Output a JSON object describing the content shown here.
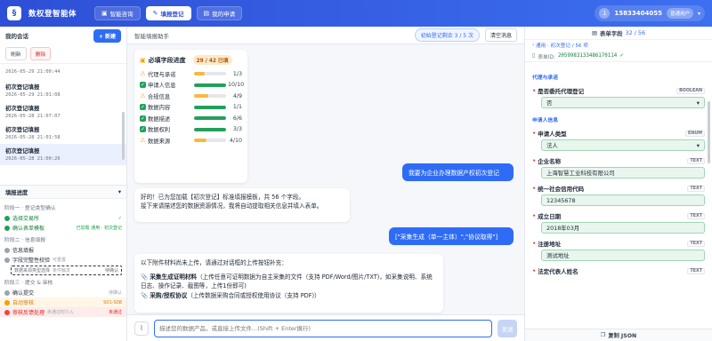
{
  "app": {
    "title": "数权登智能体",
    "logo": "§"
  },
  "nav": [
    {
      "label": "智能咨询",
      "icon": "chat-icon"
    },
    {
      "label": "填报登记",
      "icon": "form-icon"
    },
    {
      "label": "我的申请",
      "icon": "folder-icon"
    }
  ],
  "user": {
    "avatar": "1",
    "phone": "15833404055",
    "role": "普通用户"
  },
  "left": {
    "title": "我的会话",
    "new_label": "+ 新建",
    "refresh_label": "刷新",
    "delete_label": "删除",
    "conversations": [
      {
        "title": "",
        "date": "2026-05-29 21:00:44"
      },
      {
        "title": "初次登记填报",
        "date": "2026-05-29 21:01:08"
      },
      {
        "title": "初次登记填报",
        "date": "2026-05-28 21:07:07"
      },
      {
        "title": "初次登记填报",
        "date": "2026-05-28 21:01:58"
      },
      {
        "title": "初次登记填报",
        "date": "2026-05-28 21:00:26"
      }
    ],
    "progress_title": "填报进度",
    "stage1": "阶段一 · 登记类型确认",
    "s1_item1": "选择交易所",
    "s1_item1_mark": "✓",
    "s1_item2": "确认表单模板",
    "s1_item2_note": "已加载 通用 · 初次登记",
    "stage2": "阶段二 · 信息填报",
    "s2_item1": "信息填报",
    "s2_item2": "字段完整性校验",
    "s2_item2_note": "可重置",
    "s2_select": "数据来源类型选择",
    "s2_select_note": "条件触发",
    "s2_select_right": "待确认",
    "stage3": "阶段三 · 提交 & 审核",
    "s3_item1": "确认提交",
    "s3_item1_right": "待确认",
    "s3_item2": "自动审核",
    "s3_item2_right": "S01-S08",
    "s3_item3": "审核反馈处理",
    "s3_item3_note": "未通过时介入",
    "s3_item3_right": "未通过"
  },
  "center": {
    "title": "智能填报助手",
    "quota": "初始登记剩余 3 / 5 次",
    "clear_label": "清空消息",
    "card": {
      "title": "必填字段进度",
      "badge": "29 / 42 已填",
      "rows": [
        {
          "name": "代理与承诺",
          "count": "1/3",
          "fill": 0.33,
          "color": "#f5b942",
          "ok": false
        },
        {
          "name": "申请人信息",
          "count": "10/10",
          "fill": 1.0,
          "color": "#22a05b",
          "ok": true
        },
        {
          "name": "合规信息",
          "count": "4/9",
          "fill": 0.44,
          "color": "#f5b942",
          "ok": false
        },
        {
          "name": "数据内容",
          "count": "1/1",
          "fill": 1.0,
          "color": "#22a05b",
          "ok": true
        },
        {
          "name": "数据描述",
          "count": "6/6",
          "fill": 1.0,
          "color": "#22a05b",
          "ok": true
        },
        {
          "name": "数据权利",
          "count": "3/3",
          "fill": 1.0,
          "color": "#22a05b",
          "ok": true
        },
        {
          "name": "数据来源",
          "count": "4/10",
          "fill": 0.4,
          "color": "#f5b942",
          "ok": false
        }
      ]
    },
    "msg_user1": "我要为企业办理数据产权初次登记",
    "msg_bot1_line1": "好的！已为您加载【初次登记】标准填报模板，共 56 个字段。",
    "msg_bot1_line2": "接下来请描述您的数据资源情况，我将自动提取相关信息并填入表单。",
    "msg_user2": "[\"采集生成（单一主体）\",\"协议取得\"]",
    "msg_bot2_line1": "以下附件材料尚未上传，请通过对话框的上传按钮补充：",
    "msg_bot2_item1_title": "采集生成证明材料",
    "msg_bot2_item1_text": "（上传任意可证明数据为自主采集的文件（支持 PDF/Word/图片/TXT)，如采集说明、系统日志、操作记录、截图等，上传1份即可)",
    "msg_bot2_item2_title": "采购/授权协议",
    "msg_bot2_item2_text": "（上传数据采购合同或授权使用协议（支持 PDF)）",
    "input_placeholder": "描述您的数据产品，或直接上传文件...(Shift + Enter换行)",
    "send_label": "发送"
  },
  "right": {
    "title": "表单字段",
    "count": "32 / 56",
    "crumb": "通用 · 初次登记 / 56 项",
    "id_label": "表单ID:",
    "id_value": "2059983133486170114",
    "id_check": "✓",
    "section1": "代理与承诺",
    "section2": "申请人信息",
    "fields": {
      "agent_label": "是否委托代理登记",
      "agent_type": "BOOLEAN",
      "agent_value": "否",
      "type_label": "申请人类型",
      "type_type": "ENUM",
      "type_value": "法人",
      "company_label": "企业名称",
      "company_type": "TEXT",
      "company_value": "上海智慧工业科技有限公司",
      "credit_label": "统一社会信用代码",
      "credit_type": "TEXT",
      "credit_value": "12345678",
      "date_label": "成立日期",
      "date_type": "TEXT",
      "date_value": "2018年03月",
      "addr_label": "注册地址",
      "addr_type": "TEXT",
      "addr_value": "测试地址",
      "legal_label": "法定代表人姓名",
      "legal_type": "TEXT"
    },
    "copy_label": "复制 JSON"
  }
}
